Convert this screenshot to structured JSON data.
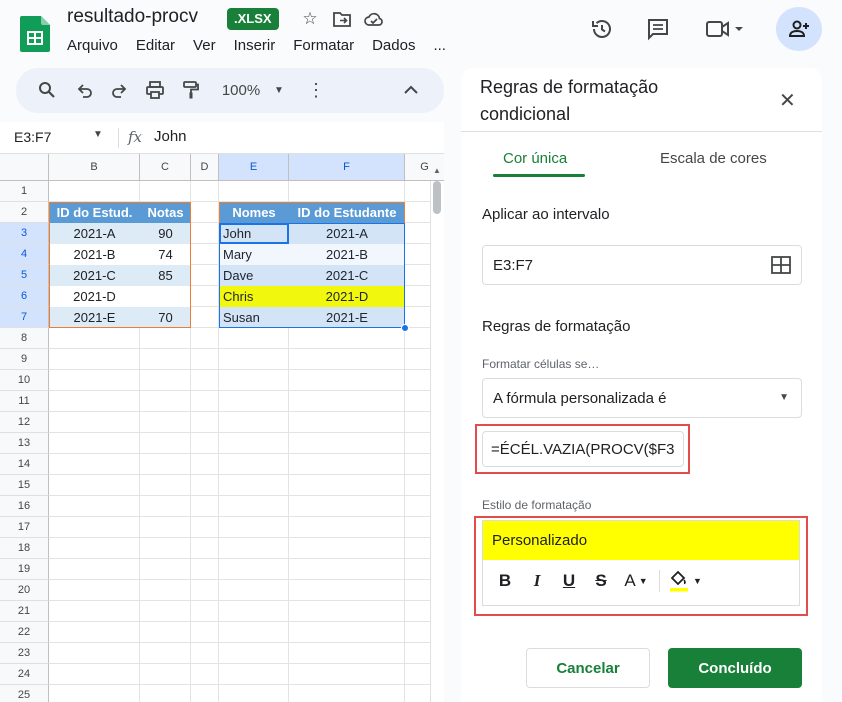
{
  "app": {
    "doc_title": "resultado-procv",
    "badge": ".XLSX",
    "menu": [
      "Arquivo",
      "Editar",
      "Ver",
      "Inserir",
      "Formatar",
      "Dados",
      "..."
    ],
    "zoom": "100%"
  },
  "formula_bar": {
    "cell_ref": "E3:F7",
    "fx": "fx",
    "value": "John"
  },
  "grid": {
    "columns": [
      "B",
      "C",
      "D",
      "E",
      "F",
      "G"
    ],
    "rows": [
      "1",
      "2",
      "3",
      "4",
      "5",
      "6",
      "7",
      "8",
      "9",
      "10",
      "11",
      "12",
      "13",
      "14",
      "15",
      "16",
      "17",
      "18",
      "19",
      "20",
      "21",
      "22",
      "23",
      "24",
      "25"
    ],
    "table1": {
      "headers": [
        "ID do Estud.",
        "Notas"
      ],
      "rows": [
        [
          "2021-A",
          "90"
        ],
        [
          "2021-B",
          "74"
        ],
        [
          "2021-C",
          "85"
        ],
        [
          "2021-D",
          ""
        ],
        [
          "2021-E",
          "70"
        ]
      ]
    },
    "table2": {
      "headers": [
        "Nomes",
        "ID do Estudante"
      ],
      "rows": [
        [
          "John",
          "2021-A"
        ],
        [
          "Mary",
          "2021-B"
        ],
        [
          "Dave",
          "2021-C"
        ],
        [
          "Chris",
          "2021-D"
        ],
        [
          "Susan",
          "2021-E"
        ]
      ]
    },
    "colors": {
      "header_bg": "#5b9bd5",
      "row_band": "#ddebf7",
      "highlight": "#ffff00",
      "border": "#ed7d31"
    }
  },
  "panel": {
    "title": "Regras de formatação condicional",
    "tabs": [
      "Cor única",
      "Escala de cores"
    ],
    "apply_range_label": "Aplicar ao intervalo",
    "apply_range_value": "E3:F7",
    "rules_label": "Regras de formatação",
    "format_cells_label": "Formatar células se…",
    "condition": "A fórmula personalizada é",
    "formula": "=ÉCÉL.VAZIA(PROCV($F3",
    "style_label": "Estilo de formatação",
    "style_preview": "Personalizado",
    "cancel": "Cancelar",
    "done": "Concluído"
  }
}
